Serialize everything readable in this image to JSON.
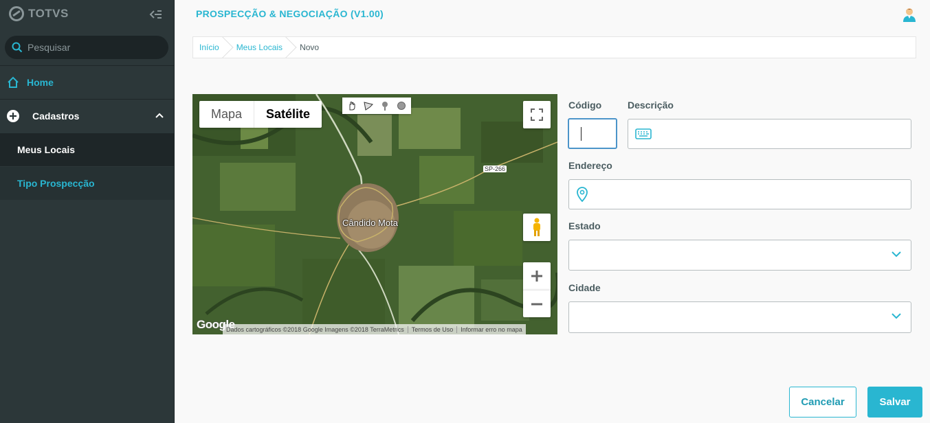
{
  "brand": {
    "name": "TOTVS"
  },
  "sidebar": {
    "search_placeholder": "Pesquisar",
    "home_label": "Home",
    "group_label": "Cadastros",
    "items": [
      {
        "label": "Meus Locais",
        "active": true
      },
      {
        "label": "Tipo Prospecção",
        "active": false
      }
    ]
  },
  "header": {
    "title": "PROSPECÇÃO & NEGOCIAÇÃO (V1.00)"
  },
  "breadcrumb": [
    "Início",
    "Meus Locais",
    "Novo"
  ],
  "map": {
    "type_map": "Mapa",
    "type_satellite": "Satélite",
    "selected_type": "Satélite",
    "city_label": "Cândido Mota",
    "road_label": "SP-266",
    "google_logo": "Google",
    "attribution": [
      "Dados cartográficos ©2018 Google Imagens ©2018 TerraMetrics",
      "Termos de Uso",
      "Informar erro no mapa"
    ],
    "draw_tools": [
      "hand-icon",
      "polygon-icon",
      "marker-icon",
      "circle-icon"
    ]
  },
  "form": {
    "codigo_label": "Código",
    "codigo_value": "",
    "descricao_label": "Descrição",
    "descricao_value": "",
    "endereco_label": "Endereço",
    "endereco_value": "",
    "estado_label": "Estado",
    "estado_value": "",
    "cidade_label": "Cidade",
    "cidade_value": ""
  },
  "actions": {
    "cancel": "Cancelar",
    "save": "Salvar"
  },
  "colors": {
    "accent": "#29b6d1",
    "sidebar_bg": "#2c3739",
    "focus_border": "#4b94c9"
  }
}
